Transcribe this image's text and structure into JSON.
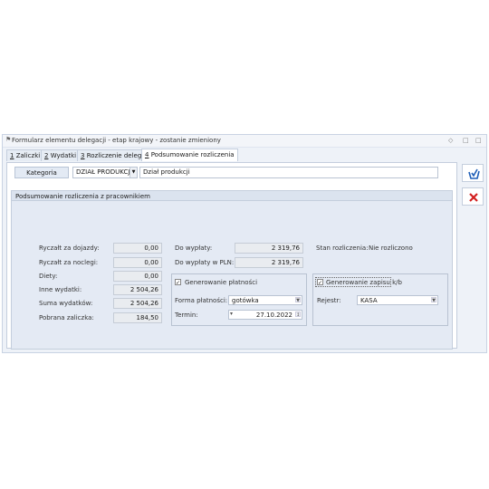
{
  "window": {
    "title": "Formularz elementu delegacji - etap krajowy - zostanie zmieniony",
    "controls": [
      "◇",
      "□",
      "□"
    ]
  },
  "tabs": [
    {
      "key": "1",
      "rest": " Zaliczki",
      "active": false
    },
    {
      "key": "2",
      "rest": " Wydatki",
      "active": false
    },
    {
      "key": "3",
      "rest": " Rozliczenie delegacji",
      "active": false
    },
    {
      "key": "4",
      "rest": " Podsumowanie rozliczenia",
      "active": true
    }
  ],
  "kategoria": {
    "button_label": "Kategoria",
    "code": "DZIAŁ PRODUKCJI",
    "description": "Dział produkcji"
  },
  "summary_group": {
    "title": "Podsumowanie rozliczenia z pracownikiem",
    "rows": [
      {
        "label": "Ryczałt za dojazdy:",
        "value": "0,00"
      },
      {
        "label": "Ryczałt za noclegi:",
        "value": "0,00"
      },
      {
        "label": "Diety:",
        "value": "0,00"
      },
      {
        "label": "Inne wydatki:",
        "value": "2 504,26"
      },
      {
        "label": "Suma wydatków:",
        "value": "2 504,26"
      },
      {
        "label": "Pobrana zaliczka:",
        "value": "184,50"
      }
    ],
    "do_wyplaty_label": "Do wypłaty:",
    "do_wyplaty_value": "2 319,76",
    "do_wyplaty_pln_label": "Do wypłaty w PLN:",
    "do_wyplaty_pln_value": "2 319,76",
    "stan_label": "Stan rozliczenia:",
    "stan_value": "Nie rozliczono"
  },
  "payment": {
    "checkbox_label": "Generowanie płatności",
    "checked": true,
    "forma_label": "Forma płatności:",
    "forma_value": "gotówka",
    "termin_label": "Termin:",
    "termin_value": "27.10.2022"
  },
  "kb": {
    "checkbox_label": "Generowanie zapisu k/b",
    "checked": true,
    "rejestr_label": "Rejestr:",
    "rejestr_value": "KASA"
  },
  "side_buttons": {
    "save_icon": "save-icon",
    "cancel_icon": "cancel-icon",
    "accent": "#1f5fb8",
    "cancel_color": "#d21f1f"
  }
}
